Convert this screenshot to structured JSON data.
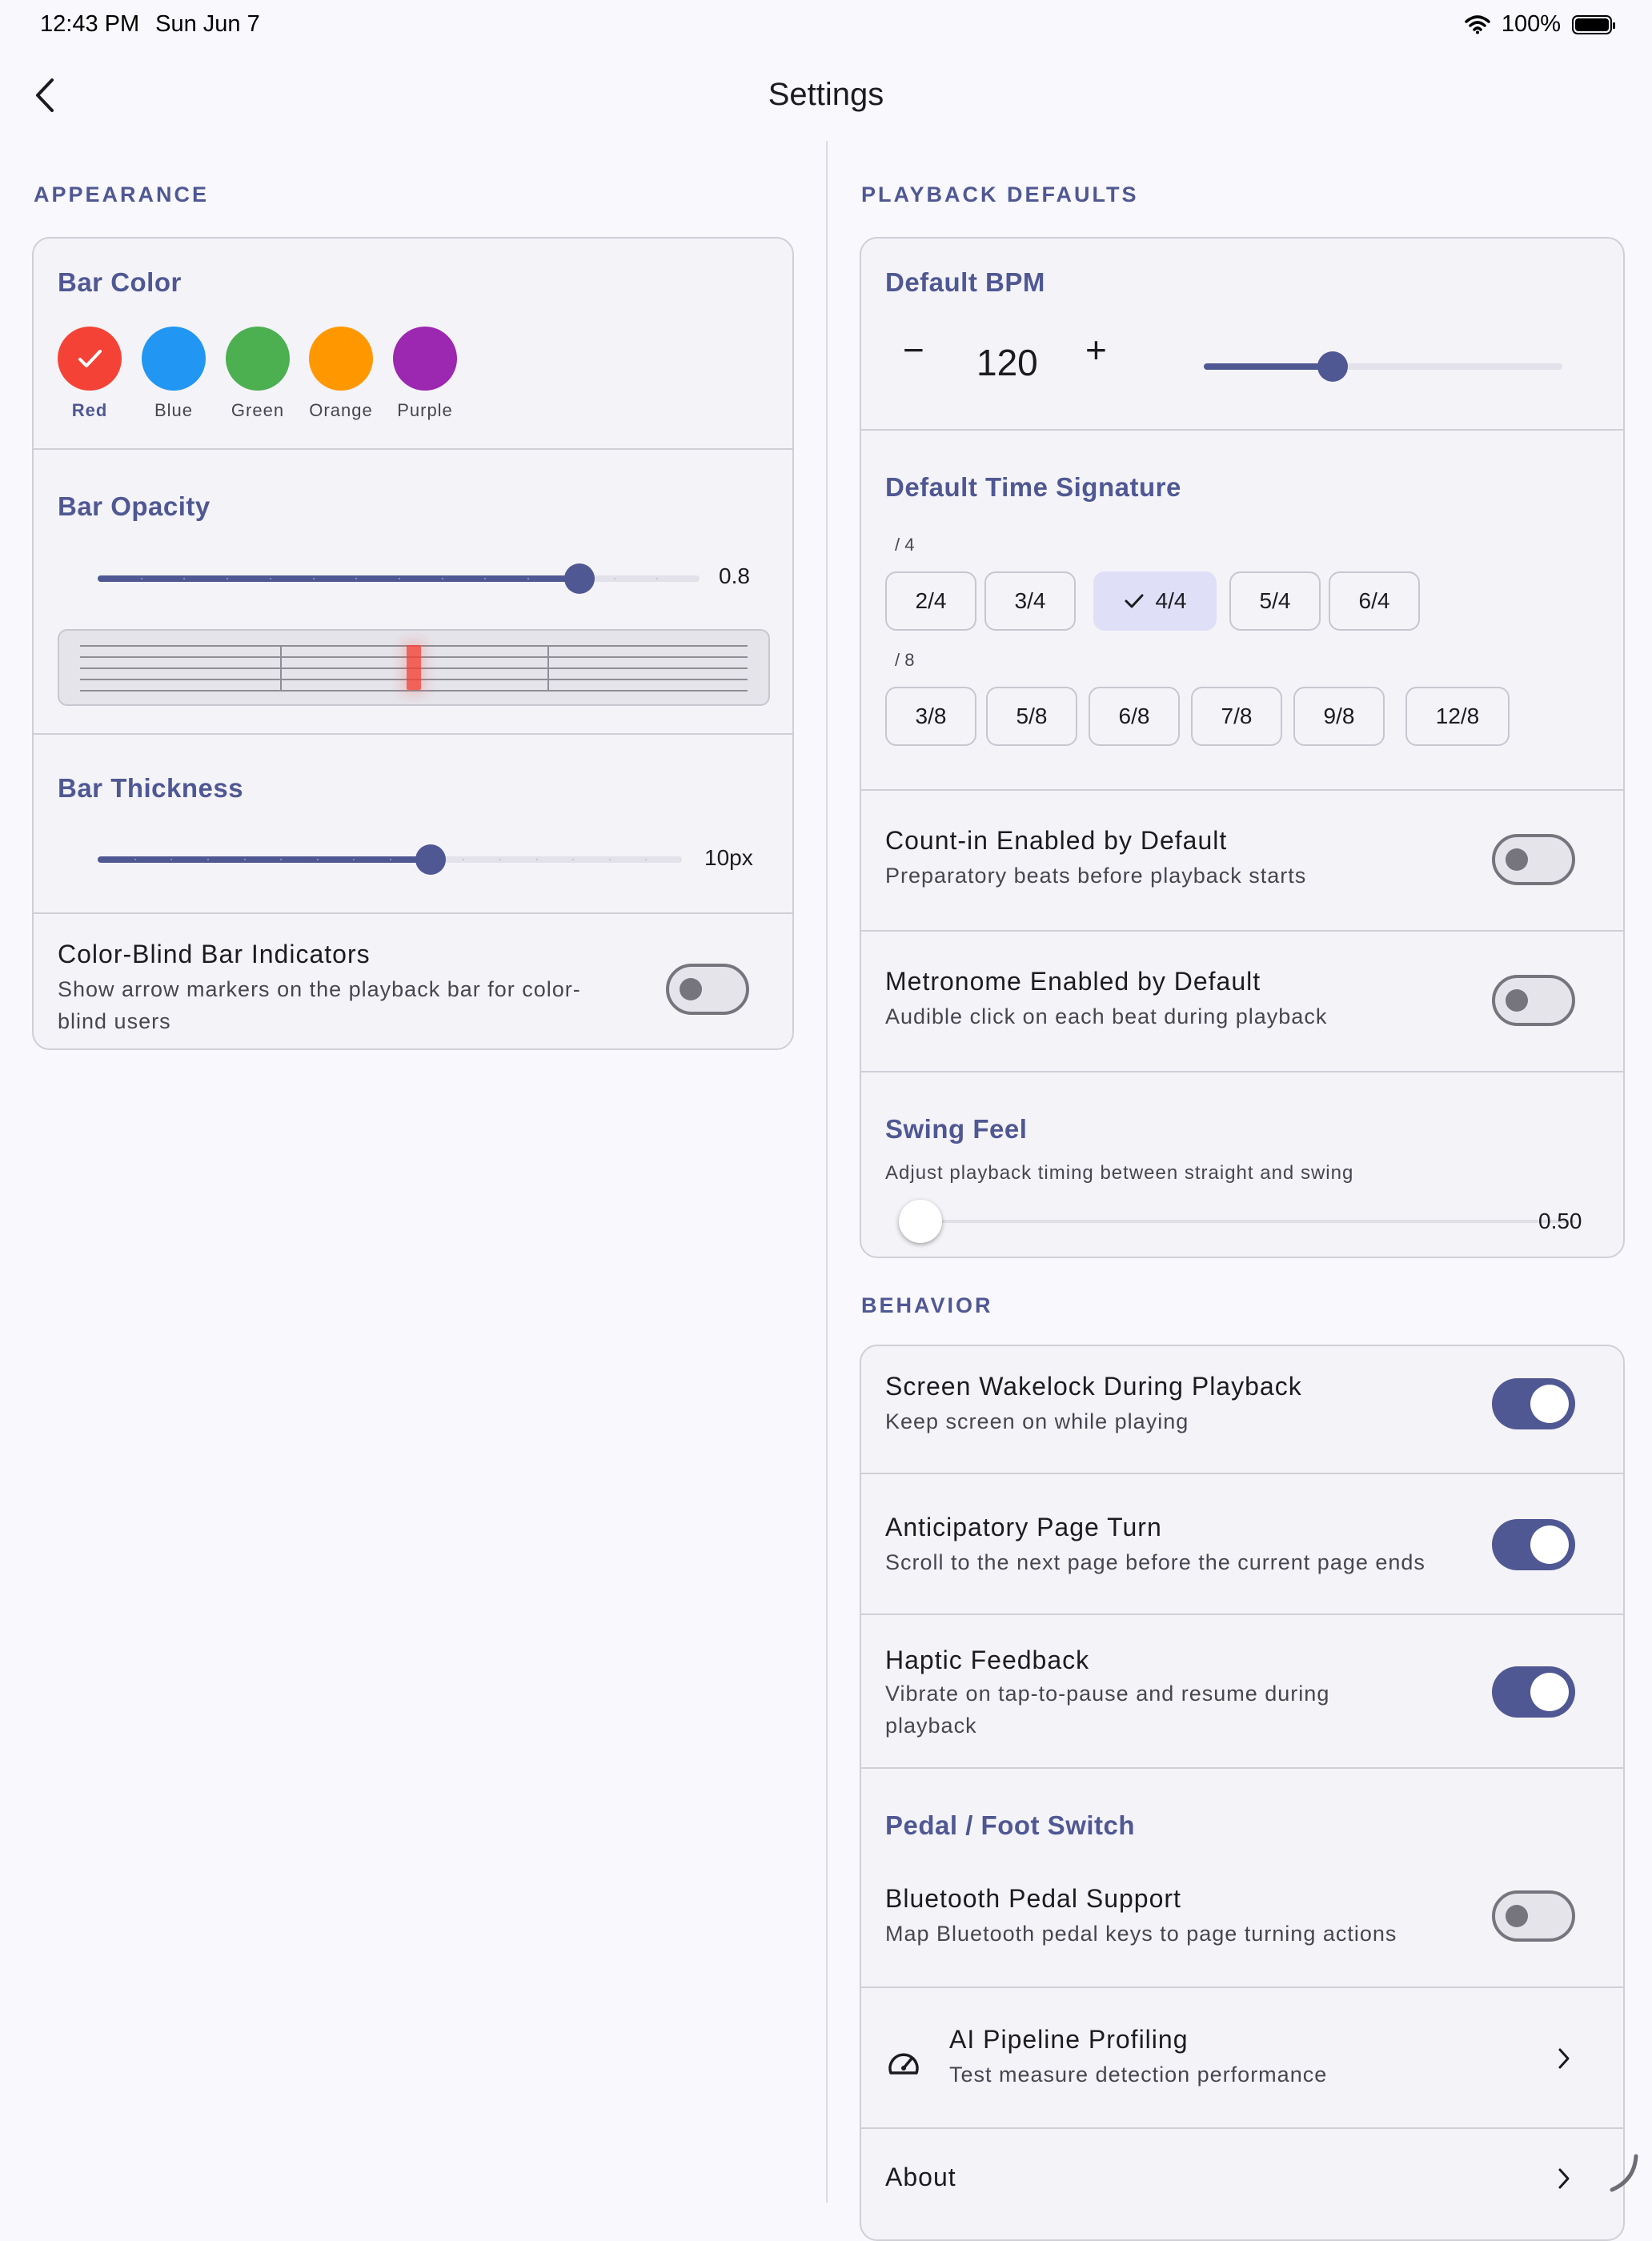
{
  "status_bar": {
    "time": "12:43 PM",
    "date": "Sun Jun 7",
    "battery": "100%"
  },
  "header": {
    "title": "Settings"
  },
  "appearance": {
    "label": "APPEARANCE",
    "bar_color": {
      "title": "Bar Color",
      "selected": "Red",
      "colors": [
        {
          "name": "Red",
          "hex": "#f44336"
        },
        {
          "name": "Blue",
          "hex": "#2196f3"
        },
        {
          "name": "Green",
          "hex": "#4caf50"
        },
        {
          "name": "Orange",
          "hex": "#ff9800"
        },
        {
          "name": "Purple",
          "hex": "#9c27b0"
        }
      ]
    },
    "bar_opacity": {
      "title": "Bar Opacity",
      "value_text": "0.8",
      "value": 0.8
    },
    "bar_thickness": {
      "title": "Bar Thickness",
      "value_text": "10px",
      "fraction": 0.57
    },
    "color_blind": {
      "title": "Color-Blind Bar Indicators",
      "subtitle_line1": "Show arrow markers on the playback bar for color-",
      "subtitle_line2": "blind users",
      "enabled": false
    }
  },
  "playback": {
    "label": "PLAYBACK DEFAULTS",
    "bpm": {
      "title": "Default BPM",
      "value": "120",
      "minus": "−",
      "plus": "+",
      "fraction": 0.36
    },
    "time_signature": {
      "title": "Default Time Signature",
      "group4_label": "/ 4",
      "group8_label": "/ 8",
      "quarter": [
        "2/4",
        "3/4",
        "4/4",
        "5/4",
        "6/4"
      ],
      "eighth": [
        "3/8",
        "5/8",
        "6/8",
        "7/8",
        "9/8",
        "12/8"
      ],
      "selected": "4/4"
    },
    "count_in": {
      "title": "Count-in Enabled by Default",
      "subtitle": "Preparatory beats before playback starts",
      "enabled": false
    },
    "metronome": {
      "title": "Metronome Enabled by Default",
      "subtitle": "Audible click on each beat during playback",
      "enabled": false
    },
    "swing": {
      "title": "Swing Feel",
      "subtitle": "Adjust playback timing between straight and swing",
      "value_text": "0.50"
    }
  },
  "behavior": {
    "label": "BEHAVIOR",
    "wakelock": {
      "title": "Screen Wakelock During Playback",
      "subtitle": "Keep screen on while playing",
      "enabled": true
    },
    "page_turn": {
      "title": "Anticipatory Page Turn",
      "subtitle": "Scroll to the next page before the current page ends",
      "enabled": true
    },
    "haptic": {
      "title": "Haptic Feedback",
      "subtitle_line1": "Vibrate on tap-to-pause and resume during",
      "subtitle_line2": "playback",
      "enabled": true
    },
    "pedal": {
      "title": "Pedal / Foot Switch",
      "item_title": "Bluetooth Pedal Support",
      "item_subtitle": "Map Bluetooth pedal keys to page turning actions",
      "enabled": false
    },
    "profiling": {
      "title": "AI Pipeline Profiling",
      "subtitle": "Test measure detection performance",
      "icon": "speedometer-icon"
    },
    "about": {
      "title": "About"
    }
  },
  "theme": {
    "accent": "#4f5893",
    "preview_bar": "#f44336"
  }
}
